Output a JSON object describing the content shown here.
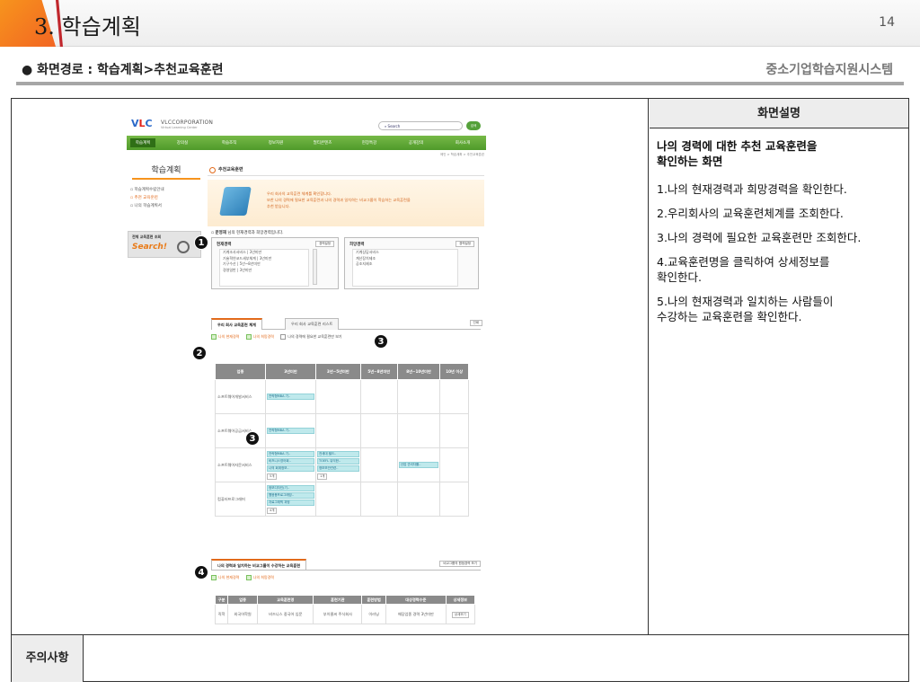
{
  "slide": {
    "section_number": "3.",
    "section_title": "학습계획",
    "page_number": "14",
    "path_label": "● 화면경로 : 학습계획>추천교육훈련",
    "system_name": "중소기업학습지원시스템"
  },
  "description_panel": {
    "header": "화면설명",
    "lead": "나의 경력에 대한 추천 교육훈련을\n 확인하는 화면",
    "items": [
      "1.나의 현재경력과 희망경력을 확인한다.",
      "2.우리회사의 교육훈련체계를 조회한다.",
      "3.나의 경력에 필요한 교육훈련만 조회한다.",
      "4.교육훈련명을 클릭하여 상세정보를\n 확인한다.",
      "5.나의 현재경력과 일치하는 사람들이\n 수강하는 교육훈련을 확인한다."
    ]
  },
  "notes": {
    "label": "주의사항",
    "content": ""
  },
  "web": {
    "logo": "VLC",
    "corp": "VLCCORPORATION",
    "corp_sub": "Virtual Learning Center",
    "search_label": "Search",
    "search_button": "검색",
    "nav": [
      "학습계획",
      "강의실",
      "학습조직",
      "정보자원",
      "멀티콘텐츠",
      "현장특강",
      "공개강의",
      "회사소개"
    ],
    "breadcrumb": "메인 > 학습계획 > 추천교육훈련",
    "side_title": "학습계획",
    "side_items": [
      "학습계획수립안내",
      "추천 교육훈련",
      "나의 학습계획서"
    ],
    "banner_title": "전체 교육훈련 조회",
    "banner_word": "Search!",
    "page_title": "추천교육훈련",
    "intro": "우리 회사의 교육훈련 체계를 확인합니다.\n또한 나의 경력에 필요한 교육훈련과 나의 경력과 일치하는 비교그룹이 학습하는 교육훈련을\n추천 받습니다.",
    "career_heading": "문영재",
    "career_heading_rest": " 님의 현재경력과 희망경력입니다.",
    "current_box": {
      "title": "현재경력",
      "button": "경력설정",
      "items": [
        "기계조사서비스 | 3년미만",
        "기술혁연코드세부체계 | 3년미만",
        "기구수산 | 5년~8년미만",
        "경영일반 | 3년미만"
      ]
    },
    "hope_box": {
      "title": "희망경력",
      "button": "경력설정",
      "items": [
        "기계상담서비스",
        "계산장치제조",
        "공조지제조"
      ]
    },
    "tabs": [
      "우리 회사 교육훈련 체계",
      "우리 회사 교육훈련 리스트"
    ],
    "print_btn": "인쇄",
    "checks": [
      "나의 현재경력",
      "나의 희망경력",
      "나의 경력에 필요한 교육훈련만 보기"
    ],
    "grid_headers": [
      "업종",
      "3년미만",
      "3년~5년미만",
      "5년~8년미만",
      "8년~10년미만",
      "10년 이상"
    ],
    "grid_rows": [
      {
        "cat": "소프트웨어개발서비스",
        "cells": [
          [
            "전략형MBA 기.."
          ],
          [],
          [],
          [],
          []
        ],
        "more": ""
      },
      {
        "cat": "소프트웨어공급서비스",
        "cells": [
          [
            "전략형MBA 기.."
          ],
          [],
          [],
          [],
          []
        ],
        "more": ""
      },
      {
        "cat": "소프트웨어자문서비스",
        "cells": [
          [
            "전략형MBA 기..",
            "비즈니스영어회..",
            "나의 회계정보.."
          ],
          [
            "전세대 필드..",
            "TOEFL 유익한..",
            "정보보안관련.."
          ],
          [],
          [
            "산업 관리자를.."
          ],
          []
        ],
        "more": "5개",
        "more2": "1개"
      },
      {
        "cat": "컴퓨터프로그래머",
        "cells": [
          [
            "정보디자인(기..",
            "웹응용프로그래밍..",
            "자료그래픽 과정"
          ],
          [],
          [],
          [],
          []
        ],
        "more": "4개"
      }
    ],
    "sec2_title": "나의 경력과 일치하는 비교그룹이 수강하는 교육훈련",
    "sec2_btn": "비교그룹의 원점경력 보기",
    "sec2_checks": [
      "나의 현재경력",
      "나의 희망경력"
    ],
    "grid2_headers": [
      "구분",
      "업종",
      "교육훈련명",
      "훈련기관",
      "훈련방법",
      "대상경력수준",
      "상세정보"
    ],
    "grid2_row": [
      "직학",
      "외국어학원",
      "비즈니스 중국어 입문",
      "부이클씨 주식회사",
      "이러닝",
      "해당업종 경력 3년미만",
      "상세보기"
    ]
  },
  "badges": [
    "1",
    "2",
    "3",
    "3",
    "4"
  ]
}
